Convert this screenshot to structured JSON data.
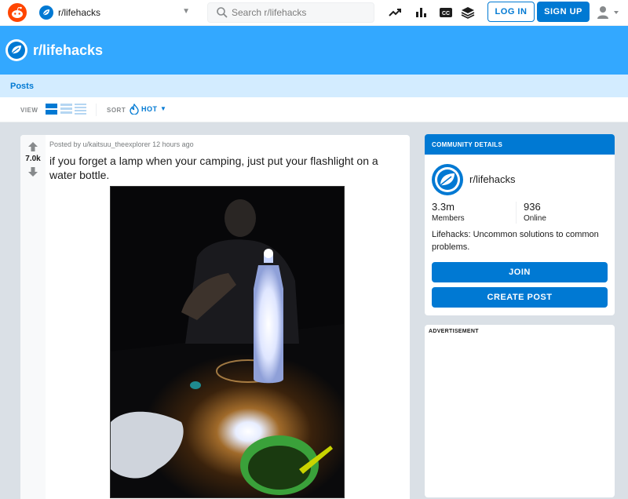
{
  "header": {
    "subreddit": "r/lifehacks",
    "search_placeholder": "Search r/lifehacks",
    "login_label": "LOG IN",
    "signup_label": "SIGN UP",
    "icons": [
      "reddit-logo-icon",
      "trending-icon",
      "stats-icon",
      "closed-caption-icon",
      "layers-icon",
      "user-icon"
    ]
  },
  "banner": {
    "title": "r/lifehacks"
  },
  "tabs": {
    "posts_label": "Posts"
  },
  "toolbar": {
    "view_label": "VIEW",
    "sort_label": "SORT",
    "sort_value": "HOT",
    "view_options": [
      "card",
      "classic",
      "compact"
    ],
    "view_selected": "card"
  },
  "post": {
    "meta": "Posted by u/kaitsuu_theexplorer 12 hours ago",
    "title": "if you forget a lamp when your camping, just put your flashlight on a water bottle.",
    "votes": "7.0k"
  },
  "community": {
    "header": "COMMUNITY DETAILS",
    "name": "r/lifehacks",
    "members_count": "3.3m",
    "members_label": "Members",
    "online_count": "936",
    "online_label": "Online",
    "description": "Lifehacks: Uncommon solutions to common problems.",
    "join_label": "JOIN",
    "create_post_label": "CREATE POST"
  },
  "ad": {
    "label": "ADVERTISEMENT"
  },
  "colors": {
    "brand_blue": "#0079d3",
    "banner_blue": "#33a8ff",
    "tab_bar": "#d3ecff",
    "background": "#dae0e6",
    "reddit_orange": "#ff4500"
  }
}
